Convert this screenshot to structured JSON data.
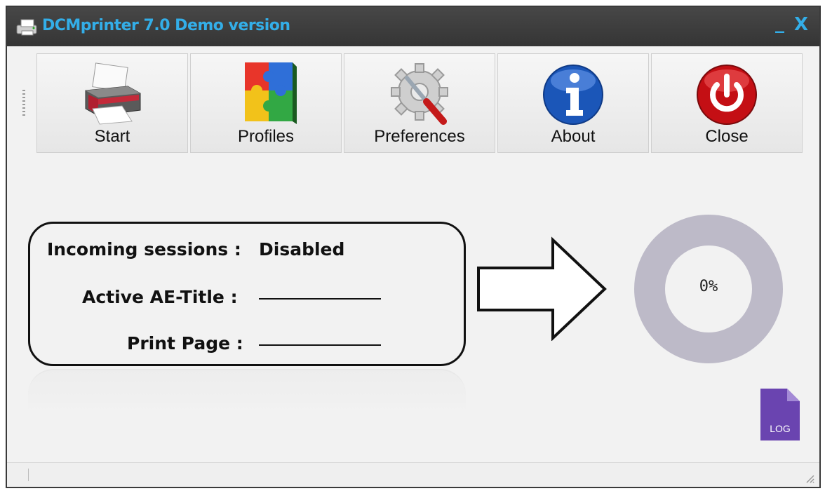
{
  "window": {
    "title": "DCMprinter 7.0 Demo version",
    "minimize_label": "_",
    "close_label": "X"
  },
  "toolbar": {
    "buttons": [
      {
        "label": "Start",
        "icon": "printer-icon"
      },
      {
        "label": "Profiles",
        "icon": "puzzle-icon"
      },
      {
        "label": "Preferences",
        "icon": "gear-wrench-icon"
      },
      {
        "label": "About",
        "icon": "info-icon"
      },
      {
        "label": "Close",
        "icon": "power-icon"
      }
    ]
  },
  "status_panel": {
    "incoming_sessions_label": "Incoming sessions :",
    "incoming_sessions_value": "Disabled",
    "active_ae_title_label": "Active AE-Title :",
    "print_page_label": "Print Page :"
  },
  "progress": {
    "value": 0,
    "text": "0%"
  },
  "log_button": {
    "label": "LOG",
    "color": "#6a44b0"
  },
  "colors": {
    "accent": "#33aee8",
    "titlebar": "#3e3e3e",
    "donut": "#bdbac8"
  }
}
